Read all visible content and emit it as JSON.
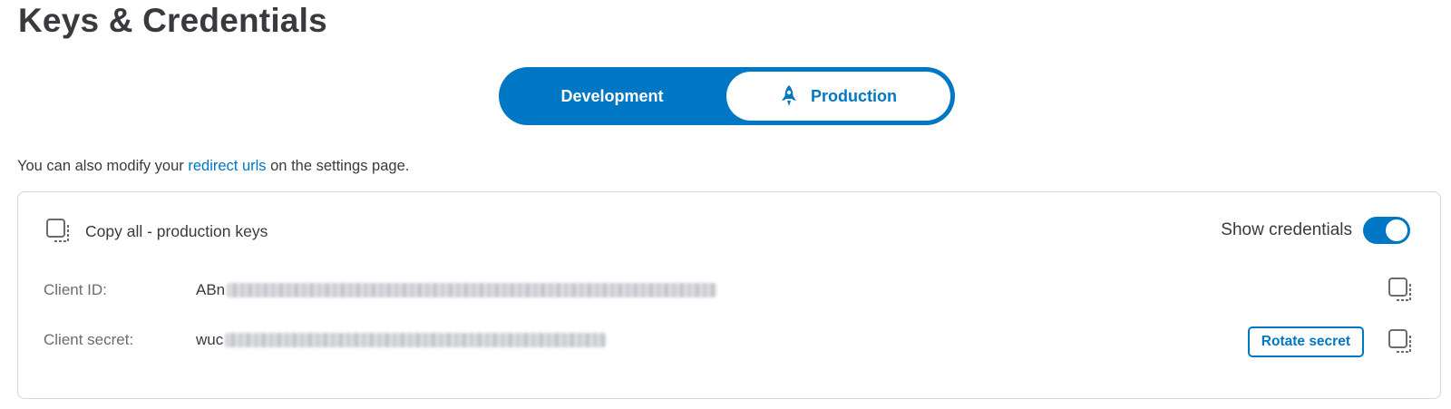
{
  "page": {
    "title": "Keys & Credentials"
  },
  "env_toggle": {
    "development_label": "Development",
    "production_label": "Production",
    "selected": "Production",
    "production_icon": "rocket-icon",
    "accent_color": "#0077c5"
  },
  "info": {
    "prefix": "You can also modify your ",
    "link_text": "redirect urls",
    "suffix": " on the settings page."
  },
  "credentials_card": {
    "copy_all_label": "Copy all - production keys",
    "copy_icon": "copy-icon",
    "show_credentials_label": "Show credentials",
    "show_credentials_on": true,
    "rows": [
      {
        "label": "Client ID:",
        "value_visible": "ABn",
        "obscured": true
      },
      {
        "label": "Client secret:",
        "value_visible": "wuc",
        "obscured": true
      }
    ],
    "rotate_secret_label": "Rotate secret"
  }
}
